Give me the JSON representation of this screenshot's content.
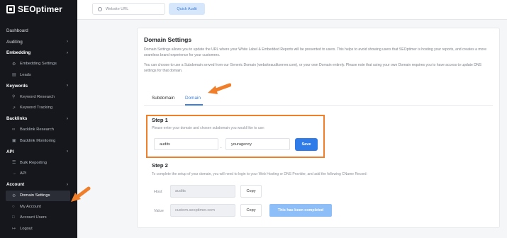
{
  "brand": {
    "name": "SEOptimer"
  },
  "sidebar": {
    "items": [
      {
        "label": "Dashboard",
        "kind": "top"
      },
      {
        "label": "Auditing",
        "kind": "top",
        "chevron": true
      },
      {
        "label": "Embedding",
        "kind": "group",
        "chevron": true
      },
      {
        "label": "Embedding Settings",
        "kind": "sub",
        "icon": "gear-icon"
      },
      {
        "label": "Leads",
        "kind": "sub",
        "icon": "leads-icon"
      },
      {
        "label": "Keywords",
        "kind": "group",
        "chevron": true
      },
      {
        "label": "Keyword Research",
        "kind": "sub",
        "icon": "search-icon"
      },
      {
        "label": "Keyword Tracking",
        "kind": "sub",
        "icon": "chart-icon"
      },
      {
        "label": "Backlinks",
        "kind": "group",
        "chevron": true
      },
      {
        "label": "Backlink Research",
        "kind": "sub",
        "icon": "link-icon"
      },
      {
        "label": "Backlink Monitoring",
        "kind": "sub",
        "icon": "monitor-icon"
      },
      {
        "label": "API",
        "kind": "group",
        "chevron": true
      },
      {
        "label": "Bulk Reporting",
        "kind": "sub",
        "icon": "report-icon"
      },
      {
        "label": "API",
        "kind": "sub",
        "icon": "api-icon"
      },
      {
        "label": "Account",
        "kind": "group",
        "chevron": true
      },
      {
        "label": "Domain Settings",
        "kind": "sub",
        "icon": "domain-icon",
        "active": true
      },
      {
        "label": "My Account",
        "kind": "sub",
        "icon": "user-icon"
      },
      {
        "label": "Account Users",
        "kind": "sub",
        "icon": "users-icon"
      },
      {
        "label": "Logout",
        "kind": "sub",
        "icon": "logout-icon"
      }
    ]
  },
  "topbar": {
    "search_placeholder": "Website URL",
    "quick_audit_label": "Quick Audit"
  },
  "main": {
    "title": "Domain Settings",
    "description1": "Domain Settings allows you to update the URL where your White Label & Embedded Reports will be presented to users. This helps to avoid showing users that SEOptimer is hosting your reports, and creates a more seamless brand experience for your customers.",
    "description2": "You can choose to use a Subdomain served from our Generic Domain (websiteauditserver.com), or your own Domain entirely. Please note that using your own Domain requires you to have access to update DNS settings for that domain.",
    "tabs": [
      {
        "label": "Subdomain",
        "active": false
      },
      {
        "label": "Domain",
        "active": true
      }
    ],
    "step1": {
      "title": "Step 1",
      "desc": "Please enter your domain and chosen subdomain you would like to use:",
      "subdomain_value": "audits",
      "separator": ".",
      "domain_value": "youragency",
      "save_label": "Save"
    },
    "step2": {
      "title": "Step 2",
      "desc": "To complete the setup of your domain, you will need to login to your Web Hosting or DNS Provider, and add the following CName Record:",
      "host_label": "Host",
      "host_value": "audits",
      "value_label": "Value",
      "value_value": "custom.seoptimer.com",
      "copy_label": "Copy",
      "completed_label": "This has been completed"
    }
  },
  "colors": {
    "accent": "#2f7ce9",
    "highlight": "#f07f2c",
    "sidebar_bg": "#15171c"
  }
}
